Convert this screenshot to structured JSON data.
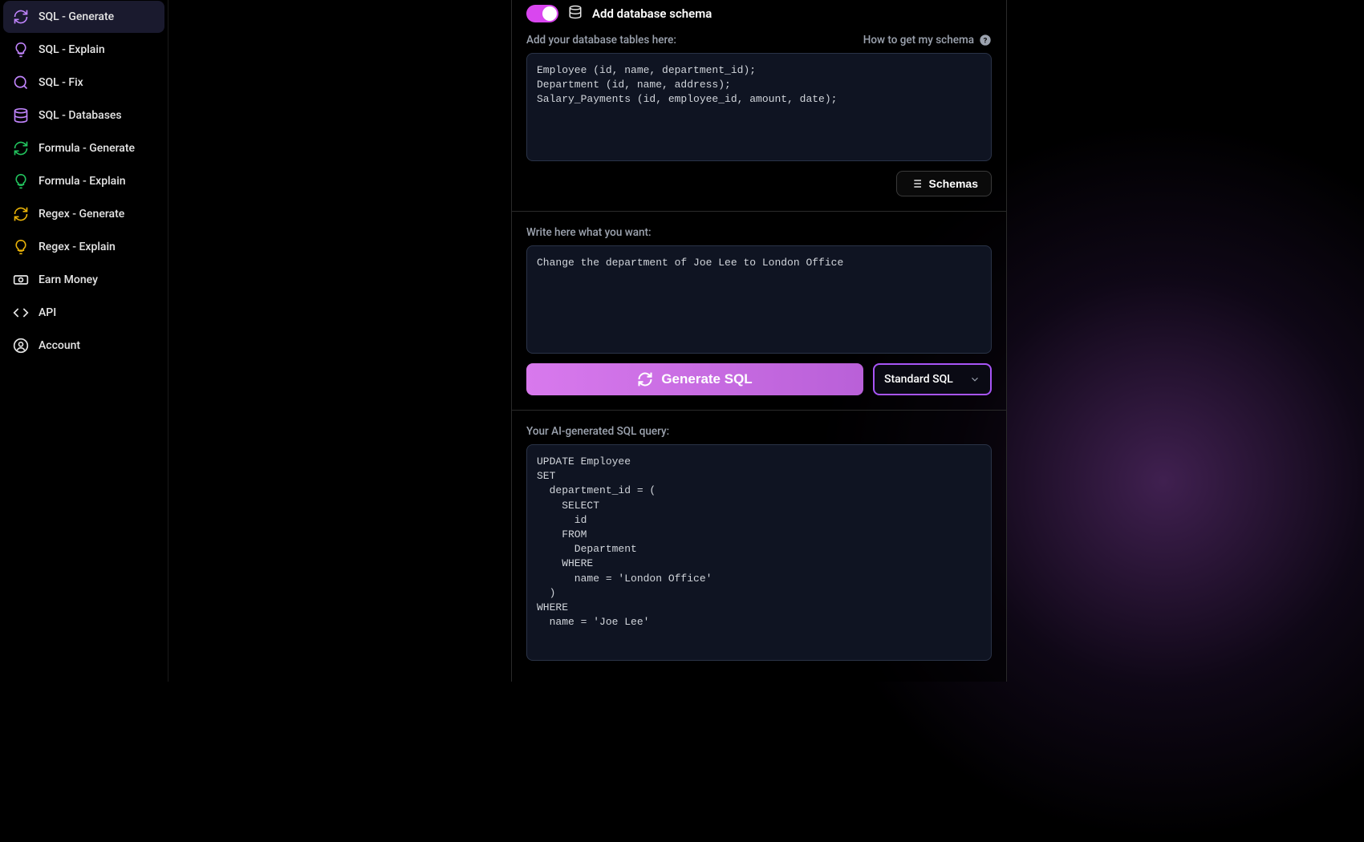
{
  "sidebar": {
    "items": [
      {
        "label": "SQL - Generate",
        "icon": "refresh",
        "color": "#c084fc",
        "active": true
      },
      {
        "label": "SQL - Explain",
        "icon": "bulb",
        "color": "#c084fc"
      },
      {
        "label": "SQL - Fix",
        "icon": "search",
        "color": "#c084fc"
      },
      {
        "label": "SQL - Databases",
        "icon": "database",
        "color": "#c084fc"
      },
      {
        "label": "Formula - Generate",
        "icon": "refresh",
        "color": "#22c55e"
      },
      {
        "label": "Formula - Explain",
        "icon": "bulb",
        "color": "#22c55e"
      },
      {
        "label": "Regex - Generate",
        "icon": "refresh",
        "color": "#eab308"
      },
      {
        "label": "Regex - Explain",
        "icon": "bulb",
        "color": "#eab308"
      },
      {
        "label": "Earn Money",
        "icon": "money",
        "color": "#e5e5e5"
      },
      {
        "label": "API",
        "icon": "code",
        "color": "#e5e5e5"
      },
      {
        "label": "Account",
        "icon": "user",
        "color": "#e5e5e5"
      }
    ]
  },
  "schema": {
    "toggle_label": "Add database schema",
    "tables_label": "Add your database tables here:",
    "help_text": "How to get my schema",
    "content": "Employee (id, name, department_id);\nDepartment (id, name, address);\nSalary_Payments (id, employee_id, amount, date);",
    "schemas_button": "Schemas"
  },
  "prompt": {
    "label": "Write here what you want:",
    "content": "Change the department of Joe Lee to London Office"
  },
  "actions": {
    "generate_label": "Generate SQL",
    "dialect_value": "Standard SQL"
  },
  "output": {
    "label": "Your AI-generated SQL query:",
    "content": "UPDATE Employee\nSET\n  department_id = (\n    SELECT\n      id\n    FROM\n      Department\n    WHERE\n      name = 'London Office'\n  )\nWHERE\n  name = 'Joe Lee'"
  }
}
